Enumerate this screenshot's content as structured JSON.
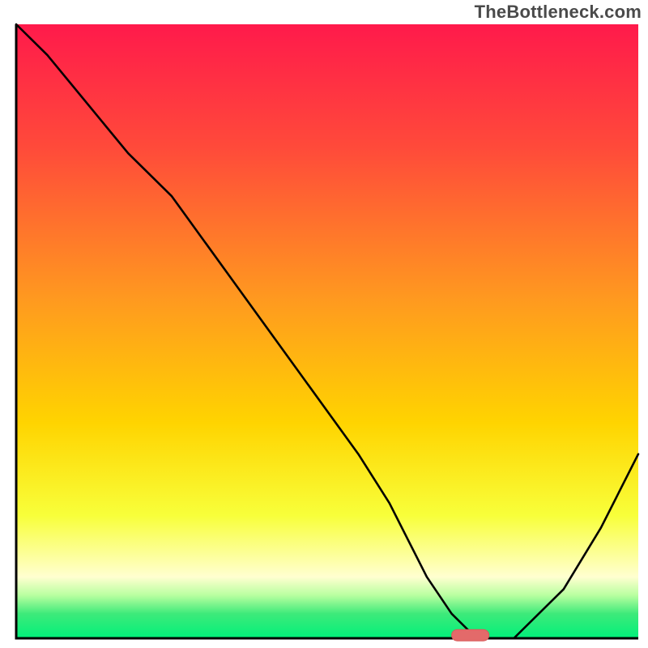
{
  "watermark": "TheBottleneck.com",
  "colors": {
    "gradient_stops": [
      {
        "offset": 0.0,
        "color": "#ff1a4b"
      },
      {
        "offset": 0.2,
        "color": "#ff4a3a"
      },
      {
        "offset": 0.45,
        "color": "#ff9a1f"
      },
      {
        "offset": 0.65,
        "color": "#ffd400"
      },
      {
        "offset": 0.8,
        "color": "#f8ff3a"
      },
      {
        "offset": 0.9,
        "color": "#ffffd0"
      },
      {
        "offset": 0.93,
        "color": "#b9ffa0"
      },
      {
        "offset": 0.96,
        "color": "#3eea7a"
      },
      {
        "offset": 1.0,
        "color": "#00f07a"
      }
    ],
    "axis": "#000000",
    "curve": "#000000",
    "marker_fill": "#e36a6a",
    "marker_stroke": "#d95a5a"
  },
  "chart_data": {
    "type": "line",
    "title": "",
    "xlabel": "",
    "ylabel": "",
    "xlim": [
      0,
      100
    ],
    "ylim": [
      0,
      100
    ],
    "x": [
      0,
      5,
      18,
      25,
      35,
      45,
      55,
      60,
      66,
      70,
      74,
      80,
      88,
      94,
      100
    ],
    "values": [
      100,
      95,
      79,
      72,
      58,
      44,
      30,
      22,
      10,
      4,
      0,
      0,
      8,
      18,
      30
    ],
    "marker": {
      "x_from": 70,
      "x_to": 76,
      "y": 0.5
    },
    "annotations": [
      "TheBottleneck.com"
    ]
  }
}
